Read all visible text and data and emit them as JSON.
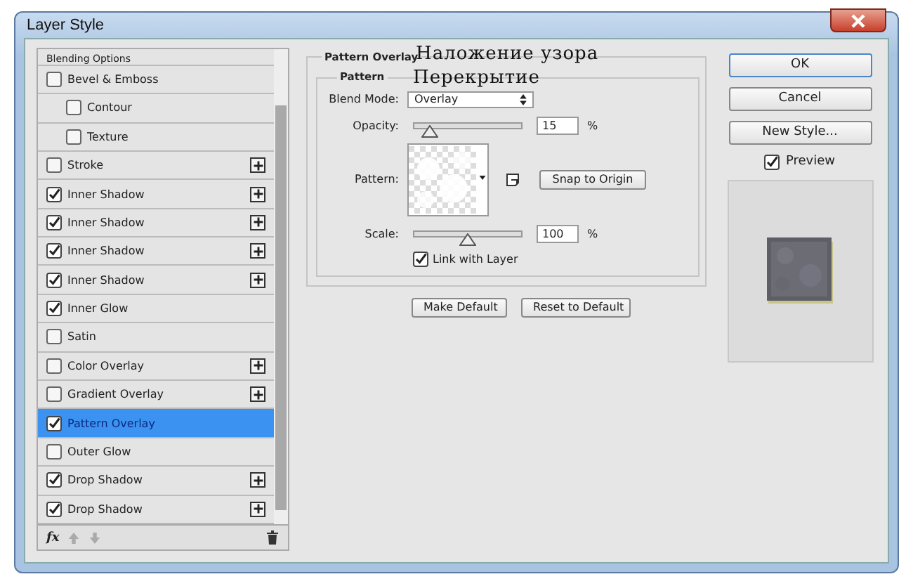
{
  "window": {
    "title": "Layer Style"
  },
  "effects": [
    {
      "label": "Blending Options",
      "kind": "header",
      "selected": false
    },
    {
      "label": "Bevel & Emboss",
      "kind": "plain",
      "checked": false,
      "selected": false,
      "children": [
        {
          "label": "Contour",
          "checked": false,
          "selected": false
        },
        {
          "label": "Texture",
          "checked": false,
          "selected": false
        }
      ]
    },
    {
      "label": "Stroke",
      "kind": "plus",
      "checked": false,
      "selected": false
    },
    {
      "label": "Inner Shadow",
      "kind": "plus",
      "checked": true,
      "selected": false
    },
    {
      "label": "Inner Shadow",
      "kind": "plus",
      "checked": true,
      "selected": false
    },
    {
      "label": "Inner Shadow",
      "kind": "plus",
      "checked": true,
      "selected": false
    },
    {
      "label": "Inner Shadow",
      "kind": "plus",
      "checked": true,
      "selected": false
    },
    {
      "label": "Inner Glow",
      "kind": "plain",
      "checked": true,
      "selected": false
    },
    {
      "label": "Satin",
      "kind": "plain",
      "checked": false,
      "selected": false
    },
    {
      "label": "Color Overlay",
      "kind": "plus",
      "checked": false,
      "selected": false
    },
    {
      "label": "Gradient Overlay",
      "kind": "plus",
      "checked": false,
      "selected": false
    },
    {
      "label": "Pattern Overlay",
      "kind": "plain",
      "checked": true,
      "selected": true
    },
    {
      "label": "Outer Glow",
      "kind": "plain",
      "checked": false,
      "selected": false
    },
    {
      "label": "Drop Shadow",
      "kind": "plus",
      "checked": true,
      "selected": false
    },
    {
      "label": "Drop Shadow",
      "kind": "plus",
      "checked": true,
      "selected": false
    }
  ],
  "list_toolbar": {
    "fx": "fx"
  },
  "panel": {
    "title": "Pattern Overlay",
    "group": "Pattern",
    "blend_mode": {
      "label": "Blend Mode:",
      "value": "Overlay"
    },
    "opacity": {
      "label": "Opacity:",
      "level": 0.15,
      "value": "15",
      "unit": "%"
    },
    "pattern": {
      "label": "Pattern:",
      "snap": "Snap to Origin"
    },
    "scale": {
      "label": "Scale:",
      "level": 0.5,
      "value": "100",
      "unit": "%"
    },
    "link": {
      "label": "Link with Layer",
      "checked": true
    },
    "buttons": [
      "Make Default",
      "Reset to Default"
    ]
  },
  "captions": [
    "Наложение узора",
    "Перекрытие"
  ],
  "buttons": [
    "OK",
    "Cancel",
    "New Style..."
  ],
  "preview": {
    "label": "Preview",
    "checked": true
  }
}
